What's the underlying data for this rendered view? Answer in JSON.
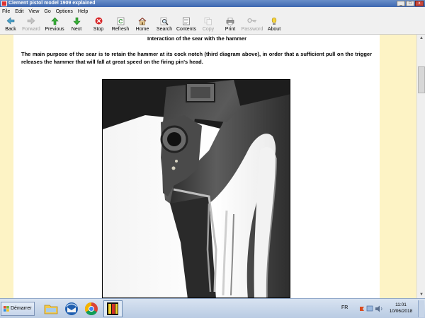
{
  "window": {
    "title": "Clement pistol model 1909 explained",
    "buttons": {
      "minimize": "_",
      "maximize": "□",
      "close": "x"
    }
  },
  "menu": [
    "File",
    "Edit",
    "View",
    "Go",
    "Options",
    "Help"
  ],
  "toolbar": [
    {
      "label": "Back",
      "icon": "back-arrow-icon",
      "enabled": true
    },
    {
      "label": "Forward",
      "icon": "forward-arrow-icon",
      "enabled": false
    },
    {
      "label": "Previous",
      "icon": "up-arrow-icon",
      "enabled": true
    },
    {
      "label": "Next",
      "icon": "down-arrow-icon",
      "enabled": true
    },
    {
      "label": "Stop",
      "icon": "stop-icon",
      "enabled": true
    },
    {
      "label": "Refresh",
      "icon": "refresh-icon",
      "enabled": true
    },
    {
      "label": "Home",
      "icon": "home-icon",
      "enabled": true
    },
    {
      "label": "Search",
      "icon": "search-icon",
      "enabled": true
    },
    {
      "label": "Contents",
      "icon": "contents-icon",
      "enabled": true
    },
    {
      "label": "Copy",
      "icon": "copy-icon",
      "enabled": false
    },
    {
      "label": "Print",
      "icon": "print-icon",
      "enabled": true
    },
    {
      "label": "Password",
      "icon": "key-icon",
      "enabled": false
    },
    {
      "label": "About",
      "icon": "about-icon",
      "enabled": true
    }
  ],
  "page": {
    "section_title": "Interaction of the sear with the hammer",
    "paragraph": "The main purpose of the sear is to retain the hammer at its cock notch (third diagram above), in order that a sufficient pull on the trigger releases the hammer that will fall at great speed on the firing pin's head."
  },
  "taskbar": {
    "start_label": "Démarrer",
    "language": "FR",
    "time": "11:01",
    "date": "10/06/2018"
  },
  "colors": {
    "page_margin": "#fdf3c5",
    "titlebar": "#3d67b1",
    "toolbar_bg": "#f0f0f0"
  }
}
